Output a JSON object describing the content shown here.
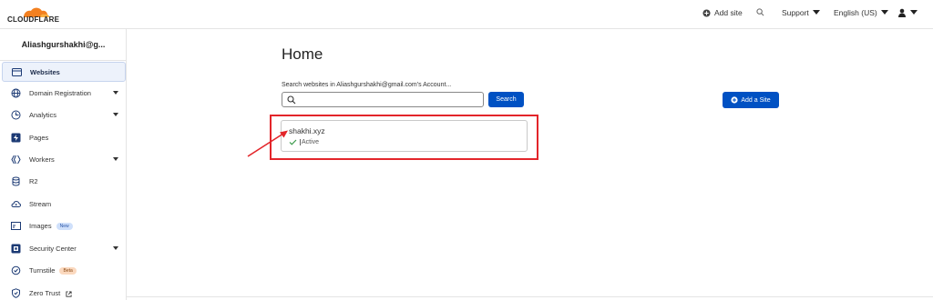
{
  "brand": {
    "name": "CLOUDFLARE",
    "accent": "#f38020"
  },
  "topbar": {
    "add_site": "Add site",
    "support": "Support",
    "language": "English (US)",
    "icons": [
      "plus-circle-icon",
      "search-icon",
      "user-icon"
    ]
  },
  "sidebar": {
    "account": "Aliashgurshakhi@g...",
    "items": [
      {
        "label": "Websites",
        "icon": "browser-window-icon",
        "active": true,
        "dropdown": false
      },
      {
        "label": "Domain Registration",
        "icon": "globe-icon",
        "dropdown": true
      },
      {
        "label": "Analytics",
        "icon": "clock-chart-icon",
        "dropdown": true
      },
      {
        "label": "Pages",
        "icon": "lightning-icon",
        "dropdown": false
      },
      {
        "label": "Workers",
        "icon": "workers-icon",
        "dropdown": true
      },
      {
        "label": "R2",
        "icon": "database-icon",
        "dropdown": false
      },
      {
        "label": "Stream",
        "icon": "cloud-icon",
        "dropdown": false
      },
      {
        "label": "Images",
        "icon": "image-icon",
        "badge": "New",
        "dropdown": false
      },
      {
        "label": "Security Center",
        "icon": "security-icon",
        "dropdown": true
      },
      {
        "label": "Turnstile",
        "icon": "turnstile-icon",
        "badge": "Beta",
        "dropdown": false
      },
      {
        "label": "Zero Trust",
        "icon": "shield-icon",
        "external": true,
        "dropdown": false
      }
    ]
  },
  "main": {
    "title": "Home",
    "search_label": "Search websites in Aliashgurshakhi@gmail.com's Account...",
    "search_value": "",
    "search_button": "Search",
    "add_button": "Add a Site",
    "sites": [
      {
        "name": "shakhi.xyz",
        "status": "Active"
      }
    ]
  },
  "colors": {
    "primary_blue": "#0051c3",
    "annotation_red": "#e3252a",
    "active_green": "#3a9a4a"
  }
}
